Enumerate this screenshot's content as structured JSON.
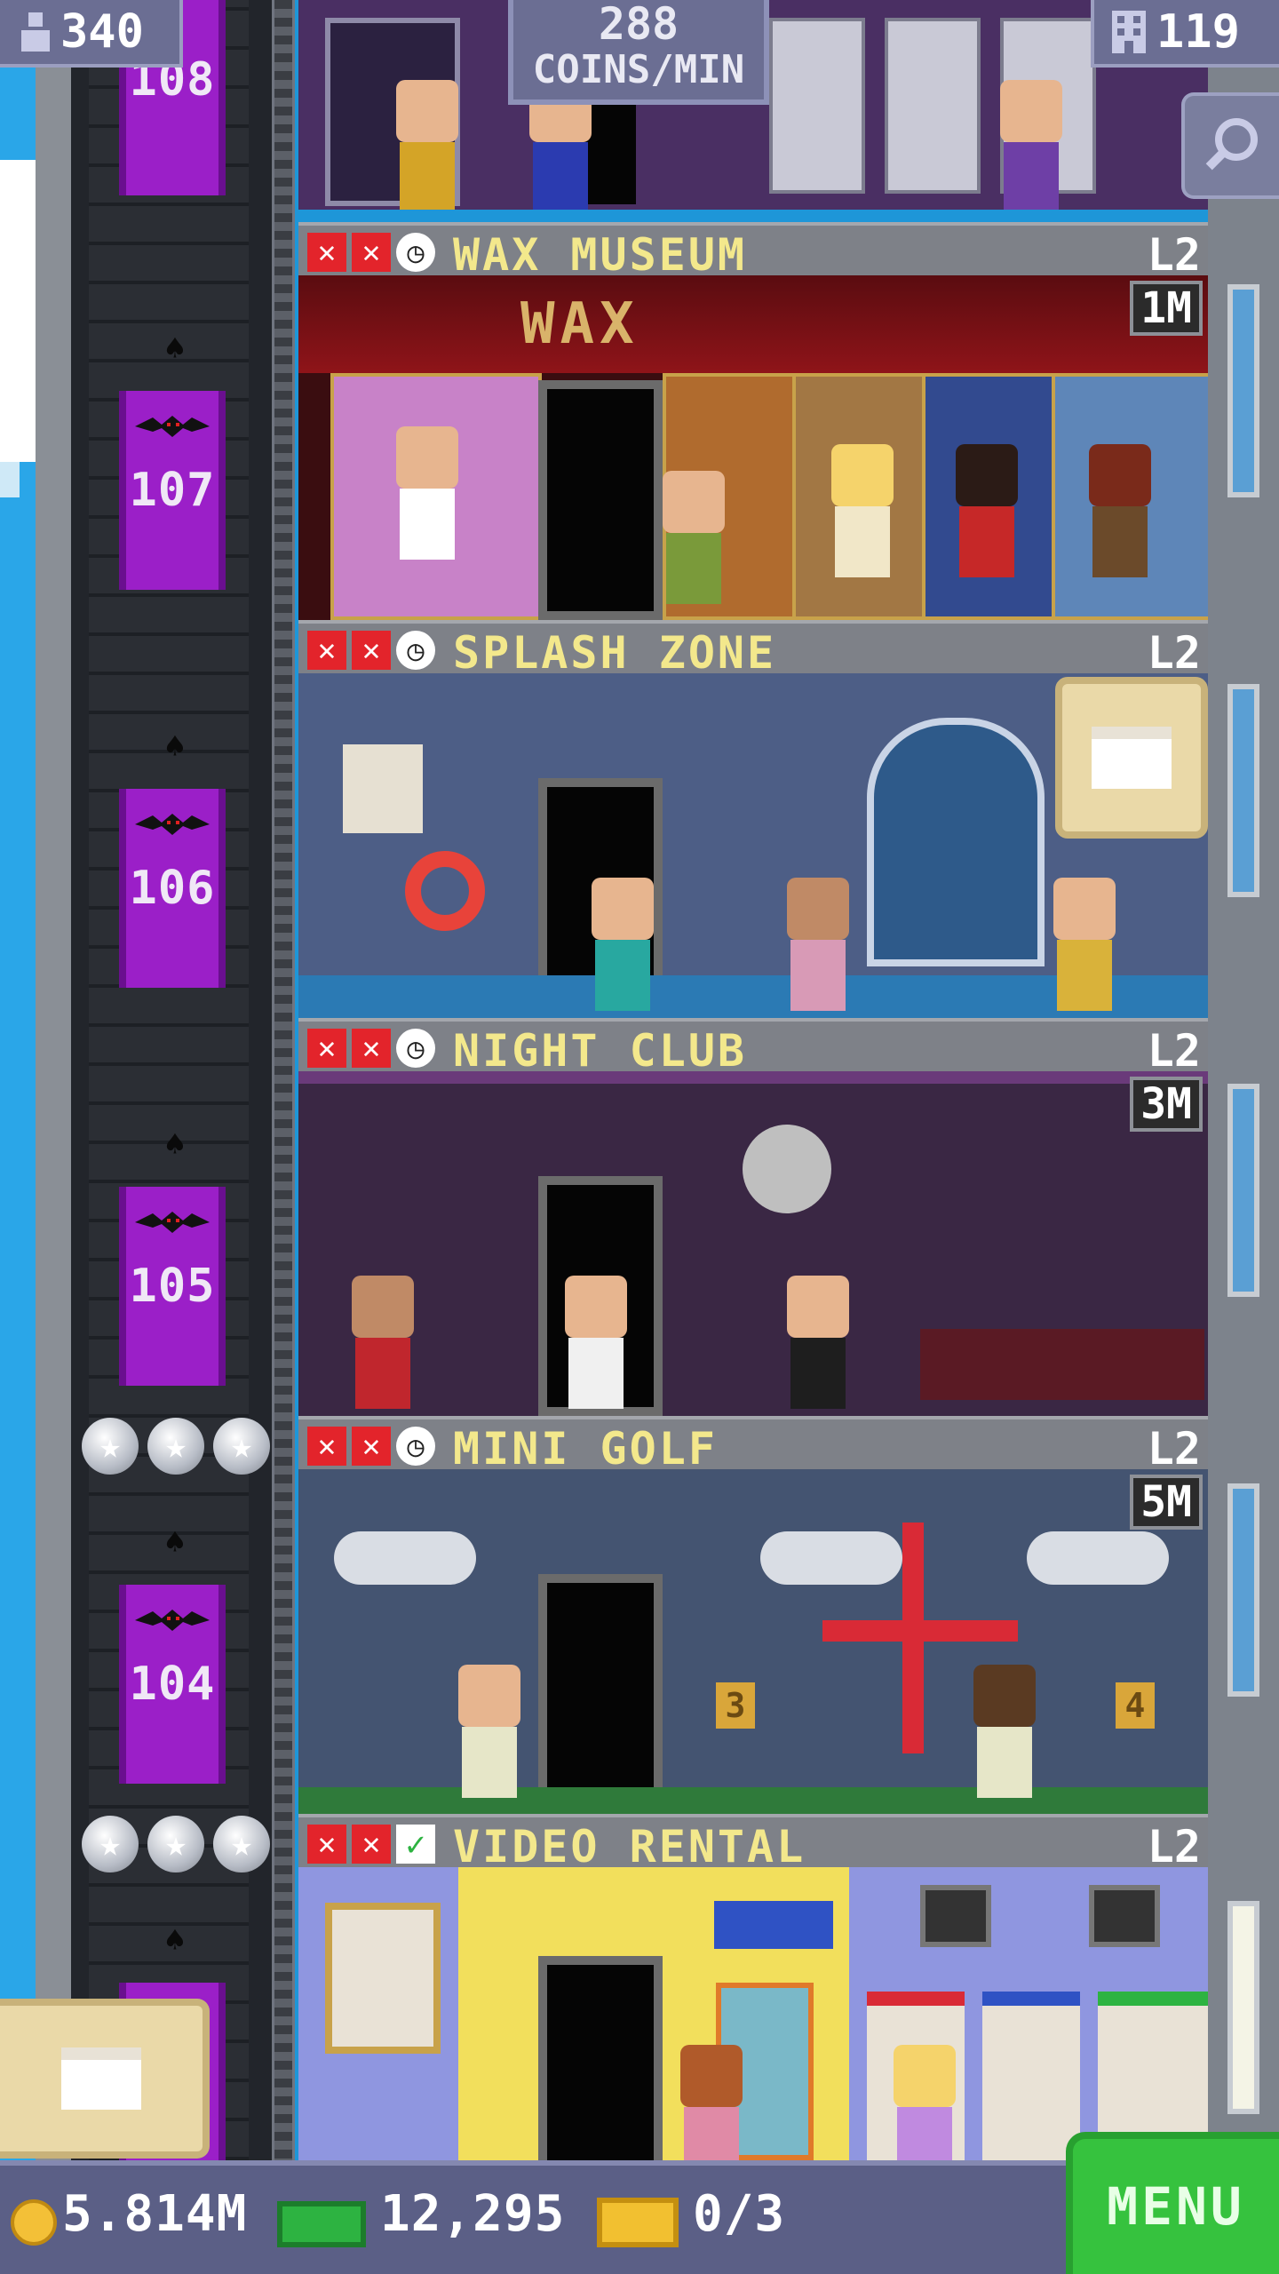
{
  "topbar": {
    "population": "340",
    "coins_per_min": "288",
    "coins_per_min_label": "COINS/MIN",
    "floors": "119"
  },
  "elevator_floors": [
    "108",
    "107",
    "106",
    "105",
    "104"
  ],
  "floors": [
    {
      "name": "WAX MUSEUM",
      "level": "L2",
      "cost": "1M",
      "status": "clock",
      "sign": "WAX"
    },
    {
      "name": "SPLASH ZONE",
      "level": "L2",
      "cost": "",
      "status": "clock"
    },
    {
      "name": "NIGHT CLUB",
      "level": "L2",
      "cost": "3M",
      "status": "clock"
    },
    {
      "name": "MINI GOLF",
      "level": "L2",
      "cost": "5M",
      "status": "clock",
      "hole_a": "3",
      "hole_b": "4"
    },
    {
      "name": "VIDEO RENTAL",
      "level": "L2",
      "cost": "",
      "status": "check"
    }
  ],
  "bottombar": {
    "coins": "5.814M",
    "bux": "12,295",
    "tickets": "0/3",
    "menu_label": "MENU"
  },
  "icons": {
    "population": "person-icon",
    "floors": "building-icon",
    "search": "magnifier-icon",
    "gift": "gift-box-icon",
    "coin": "coin-icon",
    "bux": "tower-bux-icon",
    "ticket": "golden-ticket-icon"
  },
  "colors": {
    "elevator": "#9b1fc8",
    "floor_title": "#f3e88c",
    "menu": "#36c23e"
  }
}
